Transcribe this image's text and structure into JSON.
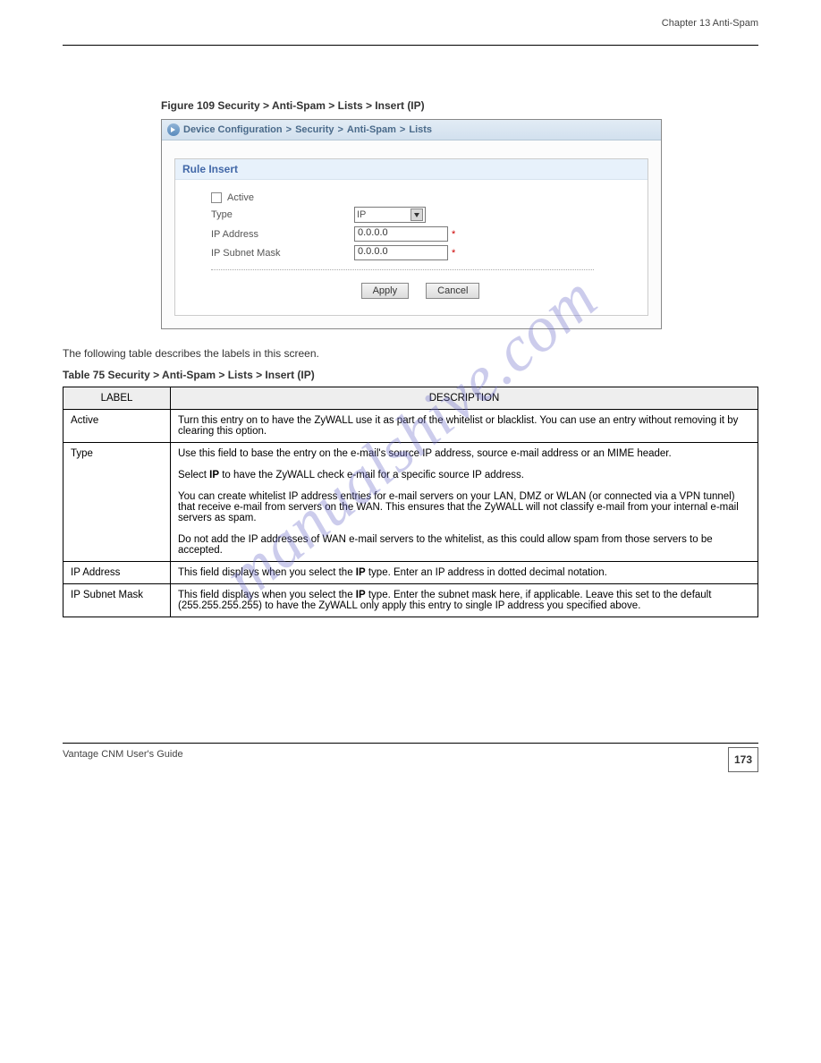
{
  "header": {
    "right": "Chapter 13 Anti-Spam"
  },
  "figure": {
    "caption": "Figure 109   Security > Anti-Spam > Lists > Insert (IP)"
  },
  "screenshot": {
    "breadcrumb": [
      "Device Configuration",
      "Security",
      "Anti-Spam",
      "Lists"
    ],
    "panel_title": "Rule Insert",
    "fields": {
      "active_label": "Active",
      "type_label": "Type",
      "type_value": "IP",
      "ip_label": "IP Address",
      "ip_value": "0.0.0.0",
      "mask_label": "IP Subnet Mask",
      "mask_value": "0.0.0.0"
    },
    "buttons": {
      "apply": "Apply",
      "cancel": "Cancel"
    }
  },
  "para": "The following table describes the labels in this screen.",
  "table": {
    "caption": "Table 75   Security > Anti-Spam > Lists > Insert (IP)",
    "head": {
      "label": "LABEL",
      "desc": "DESCRIPTION"
    },
    "rows": [
      {
        "label": "Active",
        "desc_html": "Turn this entry on to have the ZyWALL use it as part of the whitelist or blacklist. You can use an entry without removing it by clearing this option."
      },
      {
        "label": "Type",
        "desc_html": "Use this field to base the entry on the e-mail's source IP address, source e-mail address or an MIME header.<br><br>Select <b>IP</b> to have the ZyWALL check e-mail for a specific source IP address.<br><br>You can create whitelist IP address entries for e-mail servers on your LAN, DMZ or WLAN (or connected via a VPN tunnel) that receive e-mail from servers on the WAN. This ensures that the ZyWALL will not classify e-mail from your internal e-mail servers as spam.<br><br>Do not add the IP addresses of WAN e-mail servers to the whitelist, as this could allow spam from those servers to be accepted."
      },
      {
        "label": "IP Address",
        "desc_html": "This field displays when you select the <b>IP</b> type. Enter an IP address in dotted decimal notation."
      },
      {
        "label": "IP Subnet Mask",
        "desc_html": "This field displays when you select the <b>IP</b> type. Enter the subnet mask here, if applicable. Leave this set to the default (255.255.255.255) to have the ZyWALL only apply this entry to single IP address you specified above."
      }
    ]
  },
  "watermark": "manualshive.com",
  "footer": {
    "left": "Vantage CNM User's Guide",
    "page": "173"
  }
}
